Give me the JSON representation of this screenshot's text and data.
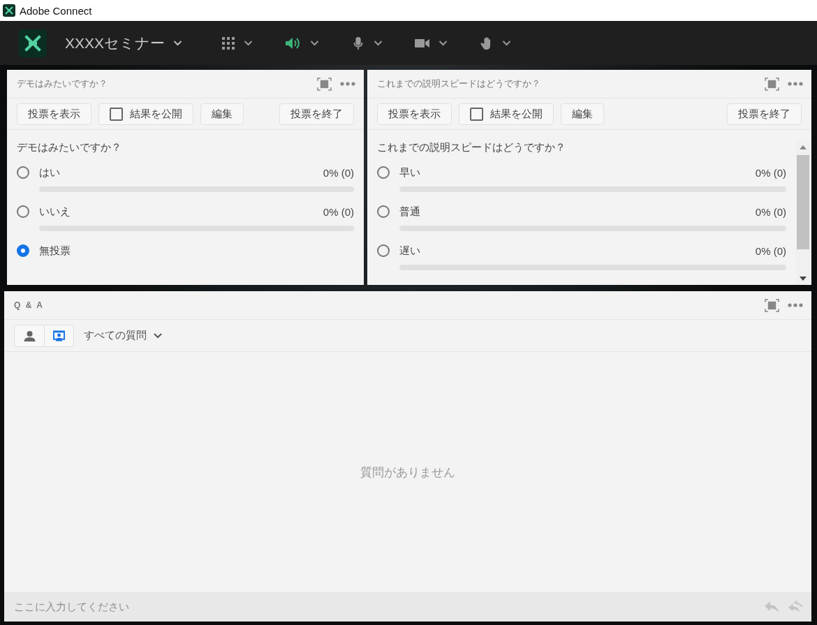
{
  "window": {
    "title": "Adobe Connect"
  },
  "toolbar": {
    "meeting_name": "XXXXセミナー",
    "audio_on": true
  },
  "polls": [
    {
      "title": "デモはみたいですか？",
      "buttons": {
        "show_votes": "投票を表示",
        "publish_results": {
          "label": "結果を公開",
          "checked": false
        },
        "edit": "編集",
        "end_poll": "投票を終了"
      },
      "question": "デモはみたいですか？",
      "scrollbar": false,
      "options": [
        {
          "label": "はい",
          "selected": false,
          "result": "0% (0)",
          "level": 0
        },
        {
          "label": "いいえ",
          "selected": false,
          "result": "0% (0)",
          "level": 0
        },
        {
          "label": "無投票",
          "selected": true
        }
      ]
    },
    {
      "title": "これまでの説明スピードはどうですか？",
      "buttons": {
        "show_votes": "投票を表示",
        "publish_results": {
          "label": "結果を公開",
          "checked": false
        },
        "edit": "編集",
        "end_poll": "投票を終了"
      },
      "question": "これまでの説明スピードはどうですか？",
      "scrollbar": true,
      "options": [
        {
          "label": "早い",
          "selected": false,
          "result": "0% (0)",
          "level": 0
        },
        {
          "label": "普通",
          "selected": false,
          "result": "0% (0)",
          "level": 0
        },
        {
          "label": "遅い",
          "selected": false,
          "result": "0% (0)",
          "level": 0
        }
      ]
    }
  ],
  "qa": {
    "title": "Q & A",
    "view_toggle": [
      {
        "kind": "participant",
        "selected": false
      },
      {
        "kind": "presenter",
        "selected": true
      }
    ],
    "filter": "すべての質問",
    "empty_message": "質問がありません",
    "input": {
      "placeholder": "ここに入力してください"
    }
  }
}
